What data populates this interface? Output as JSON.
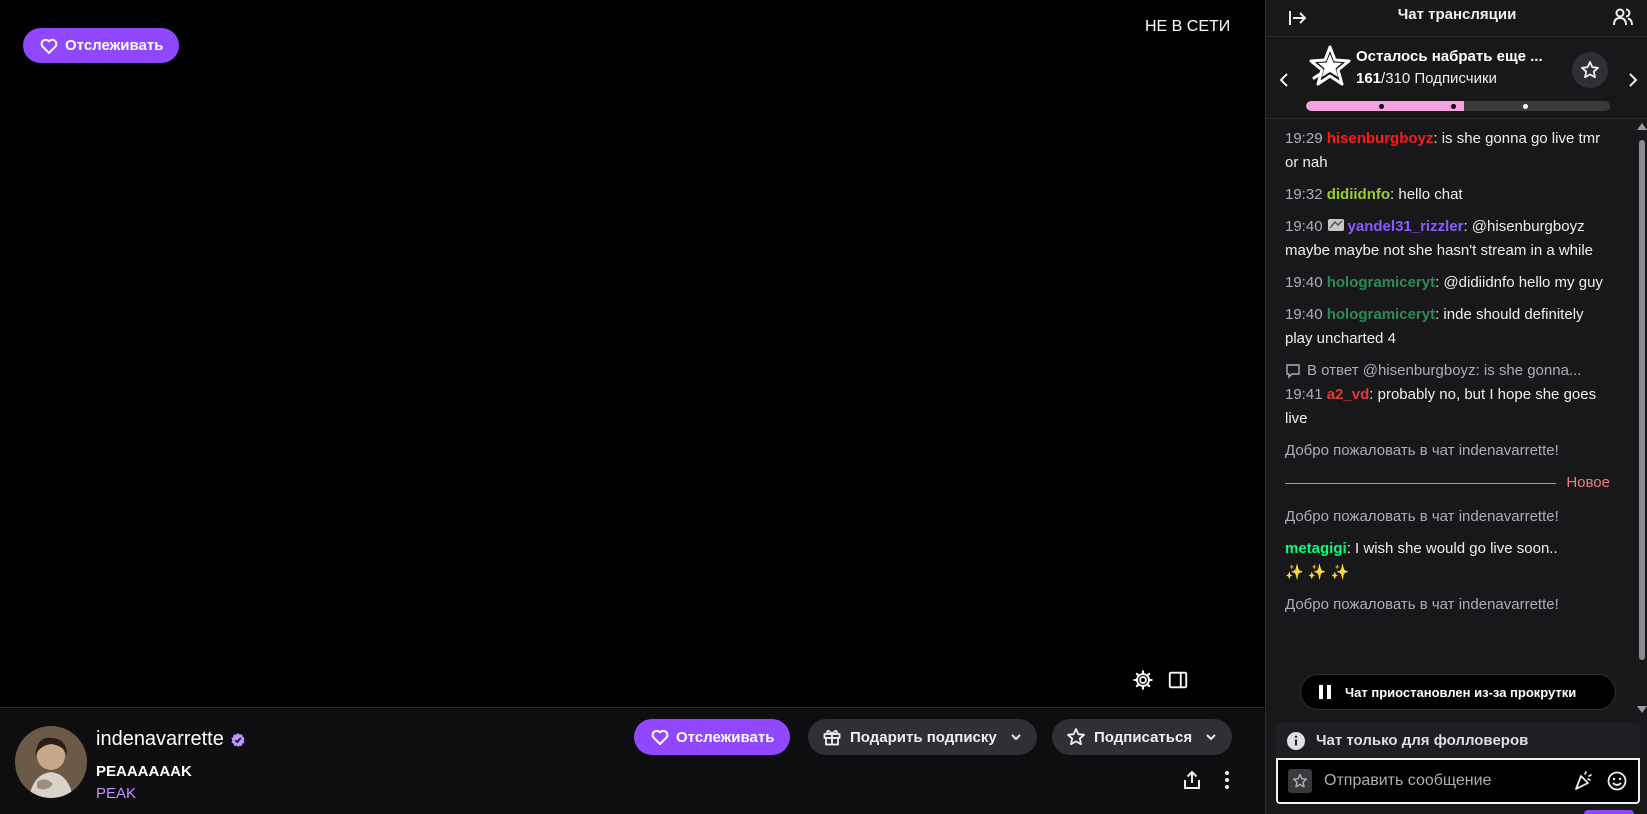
{
  "player": {
    "follow_label": "Отслеживать",
    "offline_label": "НЕ В СЕТИ"
  },
  "channel": {
    "name": "indenavarrette",
    "stream_title": "PEAAAAAAK",
    "category": "PEAK",
    "follow_label": "Отслеживать",
    "gift_label": "Подарить подписку",
    "subscribe_label": "Подписаться"
  },
  "chat": {
    "title": "Чат трансляции",
    "goal": {
      "heading": "Осталось набрать еще ...",
      "current": "161",
      "target": "/310 Подписчики",
      "progress": 0.52
    },
    "messages": [
      {
        "time": "19:29",
        "user": "hisenburgboyz",
        "color": "#ff1a1a",
        "text": ": is she gonna go live tmr or nah"
      },
      {
        "time": "19:32",
        "user": "didiidnfo",
        "color": "#9acd32",
        "text": ": hello chat"
      },
      {
        "time": "19:40",
        "user": "yandel31_rizzler",
        "color": "#8a5cff",
        "text": ": @hisenburgboyz maybe maybe not she hasn't stream in a while",
        "badge": true
      },
      {
        "time": "19:40",
        "user": "hologramiceryt",
        "color": "#2e8b57",
        "text": ": @didiidnfo hello my guy"
      },
      {
        "time": "19:40",
        "user": "hologramiceryt",
        "color": "#2e8b57",
        "text": ": inde should definitely play uncharted 4"
      },
      {
        "reply": "В ответ @hisenburgboyz: is she gonna...",
        "time": "19:41",
        "user": "a2_vd",
        "color": "#e53935",
        "text": ": probably no, but I hope she goes live"
      }
    ],
    "welcome_1": "Добро пожаловать в чат indenavarrette!",
    "new_label": "Новое",
    "welcome_2": "Добро пожаловать в чат indenavarrette!",
    "late_message": {
      "user": "metagigi",
      "color": "#00ff7f",
      "text": ": I wish she would go live soon..",
      "emotes": "✨ ✨ ✨"
    },
    "welcome_3": "Добро пожаловать в чат indenavarrette!",
    "paused_label": "Чат приостановлен из-за прокрутки",
    "followers_only": "Чат только для фолловеров",
    "input_placeholder": "Отправить сообщение"
  },
  "colors": {
    "accent": "#9147ff",
    "goal_fill": "#f4a3e0",
    "new_divider": "#eb7f7f"
  },
  "icons": [
    "heart-icon",
    "settings-gear-icon",
    "theatre-mode-icon",
    "verified-badge-icon",
    "gift-icon",
    "star-icon",
    "chevron-down-icon",
    "share-icon",
    "more-vertical-icon",
    "collapse-chat-icon",
    "community-icon",
    "goal-star-icon",
    "chevron-left-icon",
    "chevron-right-icon",
    "reply-icon",
    "pause-icon",
    "info-icon",
    "emote-icon",
    "bits-icon"
  ]
}
